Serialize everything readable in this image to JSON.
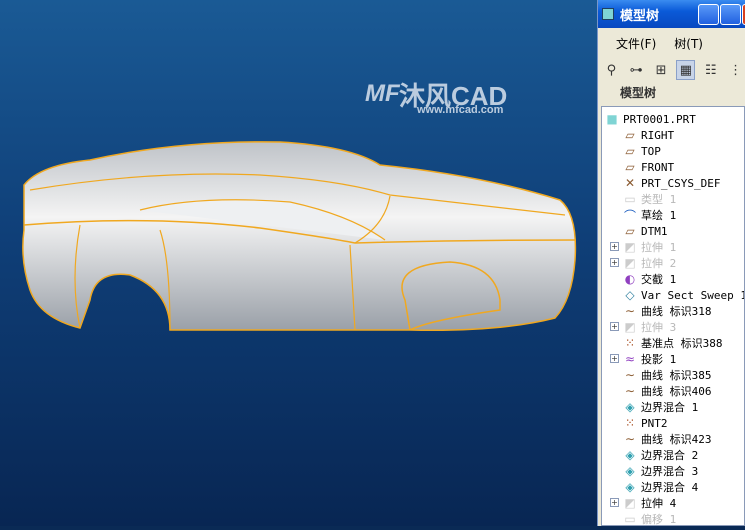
{
  "watermark": {
    "brand": "沐风CAD",
    "url": "www.mfcad.com",
    "mark": "MF"
  },
  "panel": {
    "title": "模型树",
    "menu": [
      "文件(F)",
      "树(T)"
    ],
    "toolbar_icons": [
      "binoculars-icon",
      "tree-filter-icon",
      "tree-columns-icon",
      "show-tree-icon",
      "settings-icon",
      "more-icon"
    ],
    "tree_label": "模型树",
    "items": [
      {
        "label": "PRT0001.PRT",
        "icon": "part-icon",
        "root": true
      },
      {
        "label": "RIGHT",
        "icon": "datum-plane-icon"
      },
      {
        "label": "TOP",
        "icon": "datum-plane-icon"
      },
      {
        "label": "FRONT",
        "icon": "datum-plane-icon"
      },
      {
        "label": "PRT_CSYS_DEF",
        "icon": "csys-icon"
      },
      {
        "label": "类型 1",
        "icon": "style-icon",
        "gray": true
      },
      {
        "label": "草绘 1",
        "icon": "sketch-icon"
      },
      {
        "label": "DTM1",
        "icon": "datum-plane-icon"
      },
      {
        "label": "拉伸 1",
        "icon": "extrude-icon",
        "gray": true,
        "expand": true
      },
      {
        "label": "拉伸 2",
        "icon": "extrude-icon",
        "gray": true,
        "expand": true
      },
      {
        "label": "交截 1",
        "icon": "intersect-icon"
      },
      {
        "label": "Var Sect Sweep 1",
        "icon": "sweep-icon"
      },
      {
        "label": "曲线 标识318",
        "icon": "curve-icon"
      },
      {
        "label": "拉伸 3",
        "icon": "extrude-icon",
        "gray": true,
        "expand": true
      },
      {
        "label": "基准点 标识388",
        "icon": "datum-point-icon"
      },
      {
        "label": "投影 1",
        "icon": "projection-icon",
        "expand": true
      },
      {
        "label": "曲线 标识385",
        "icon": "curve-icon"
      },
      {
        "label": "曲线 标识406",
        "icon": "curve-icon"
      },
      {
        "label": "边界混合 1",
        "icon": "boundary-blend-icon"
      },
      {
        "label": "PNT2",
        "icon": "datum-point-icon"
      },
      {
        "label": "曲线 标识423",
        "icon": "curve-icon"
      },
      {
        "label": "边界混合 2",
        "icon": "boundary-blend-icon"
      },
      {
        "label": "边界混合 3",
        "icon": "boundary-blend-icon"
      },
      {
        "label": "边界混合 4",
        "icon": "boundary-blend-icon"
      },
      {
        "label": "拉伸 4",
        "icon": "extrude-icon",
        "expand": true
      },
      {
        "label": "偏移 1",
        "icon": "offset-icon",
        "gray": true
      }
    ]
  }
}
